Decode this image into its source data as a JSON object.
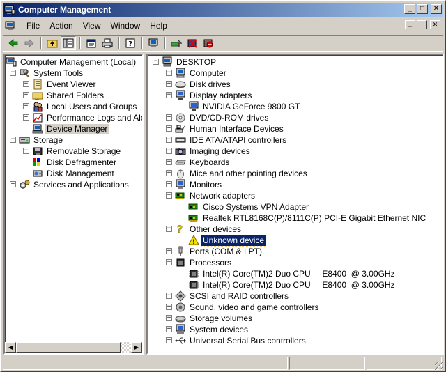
{
  "window": {
    "title": "Computer Management"
  },
  "menu": [
    "File",
    "Action",
    "View",
    "Window",
    "Help"
  ],
  "toolbar": [
    "back-arrow-icon",
    "forward-arrow-icon",
    "up-folder-icon",
    "show-tree-icon",
    "properties-icon",
    "print-icon",
    "help-icon",
    "computer-icon",
    "scan-hardware-icon",
    "uninstall-icon",
    "disable-icon"
  ],
  "left_tree": [
    {
      "label": "Computer Management (Local)",
      "icon": "computer-management-icon",
      "depth": 0,
      "exp": ""
    },
    {
      "label": "System Tools",
      "icon": "system-tools-icon",
      "depth": 1,
      "exp": "-"
    },
    {
      "label": "Event Viewer",
      "icon": "event-viewer-icon",
      "depth": 2,
      "exp": "+"
    },
    {
      "label": "Shared Folders",
      "icon": "shared-folder-icon",
      "depth": 2,
      "exp": "+"
    },
    {
      "label": "Local Users and Groups",
      "icon": "users-icon",
      "depth": 2,
      "exp": "+"
    },
    {
      "label": "Performance Logs and Alerts",
      "icon": "performance-icon",
      "depth": 2,
      "exp": "+"
    },
    {
      "label": "Device Manager",
      "icon": "device-manager-icon",
      "depth": 2,
      "exp": "",
      "selected": true
    },
    {
      "label": "Storage",
      "icon": "storage-icon",
      "depth": 1,
      "exp": "-"
    },
    {
      "label": "Removable Storage",
      "icon": "removable-storage-icon",
      "depth": 2,
      "exp": "+"
    },
    {
      "label": "Disk Defragmenter",
      "icon": "defrag-icon",
      "depth": 2,
      "exp": ""
    },
    {
      "label": "Disk Management",
      "icon": "disk-management-icon",
      "depth": 2,
      "exp": ""
    },
    {
      "label": "Services and Applications",
      "icon": "services-icon",
      "depth": 1,
      "exp": "+"
    }
  ],
  "right_tree": [
    {
      "label": "DESKTOP",
      "icon": "computer-icon",
      "depth": 0,
      "exp": "-"
    },
    {
      "label": "Computer",
      "icon": "computer-icon",
      "depth": 1,
      "exp": "+"
    },
    {
      "label": "Disk drives",
      "icon": "disk-drive-icon",
      "depth": 1,
      "exp": "+"
    },
    {
      "label": "Display adapters",
      "icon": "display-adapter-icon",
      "depth": 1,
      "exp": "-"
    },
    {
      "label": "NVIDIA GeForce 9800 GT",
      "icon": "display-adapter-icon",
      "depth": 2,
      "exp": ""
    },
    {
      "label": "DVD/CD-ROM drives",
      "icon": "cdrom-icon",
      "depth": 1,
      "exp": "+"
    },
    {
      "label": "Human Interface Devices",
      "icon": "hid-icon",
      "depth": 1,
      "exp": "+"
    },
    {
      "label": "IDE ATA/ATAPI controllers",
      "icon": "ide-icon",
      "depth": 1,
      "exp": "+"
    },
    {
      "label": "Imaging devices",
      "icon": "camera-icon",
      "depth": 1,
      "exp": "+"
    },
    {
      "label": "Keyboards",
      "icon": "keyboard-icon",
      "depth": 1,
      "exp": "+"
    },
    {
      "label": "Mice and other pointing devices",
      "icon": "mouse-icon",
      "depth": 1,
      "exp": "+"
    },
    {
      "label": "Monitors",
      "icon": "monitor-icon",
      "depth": 1,
      "exp": "+"
    },
    {
      "label": "Network adapters",
      "icon": "network-card-icon",
      "depth": 1,
      "exp": "-"
    },
    {
      "label": "Cisco Systems VPN Adapter",
      "icon": "network-card-icon",
      "depth": 2,
      "exp": ""
    },
    {
      "label": "Realtek RTL8168C(P)/8111C(P) PCI-E Gigabit Ethernet NIC",
      "icon": "network-card-icon",
      "depth": 2,
      "exp": ""
    },
    {
      "label": "Other devices",
      "icon": "unknown-device-icon",
      "depth": 1,
      "exp": "-"
    },
    {
      "label": "Unknown device",
      "icon": "warning-device-icon",
      "depth": 2,
      "exp": "",
      "selected": true
    },
    {
      "label": "Ports (COM & LPT)",
      "icon": "port-icon",
      "depth": 1,
      "exp": "+"
    },
    {
      "label": "Processors",
      "icon": "processor-icon",
      "depth": 1,
      "exp": "-"
    },
    {
      "label": "Intel(R) Core(TM)2 Duo CPU     E8400  @ 3.00GHz",
      "icon": "processor-icon",
      "depth": 2,
      "exp": ""
    },
    {
      "label": "Intel(R) Core(TM)2 Duo CPU     E8400  @ 3.00GHz",
      "icon": "processor-icon",
      "depth": 2,
      "exp": ""
    },
    {
      "label": "SCSI and RAID controllers",
      "icon": "scsi-icon",
      "depth": 1,
      "exp": "+"
    },
    {
      "label": "Sound, video and game controllers",
      "icon": "sound-icon",
      "depth": 1,
      "exp": "+"
    },
    {
      "label": "Storage volumes",
      "icon": "storage-volume-icon",
      "depth": 1,
      "exp": "+"
    },
    {
      "label": "System devices",
      "icon": "system-device-icon",
      "depth": 1,
      "exp": "+"
    },
    {
      "label": "Universal Serial Bus controllers",
      "icon": "usb-icon",
      "depth": 1,
      "exp": "+"
    }
  ],
  "colors": {
    "title_start": "#0a246a",
    "title_end": "#a6caf0",
    "chrome": "#d4d0c8",
    "selection": "#0a246a"
  }
}
